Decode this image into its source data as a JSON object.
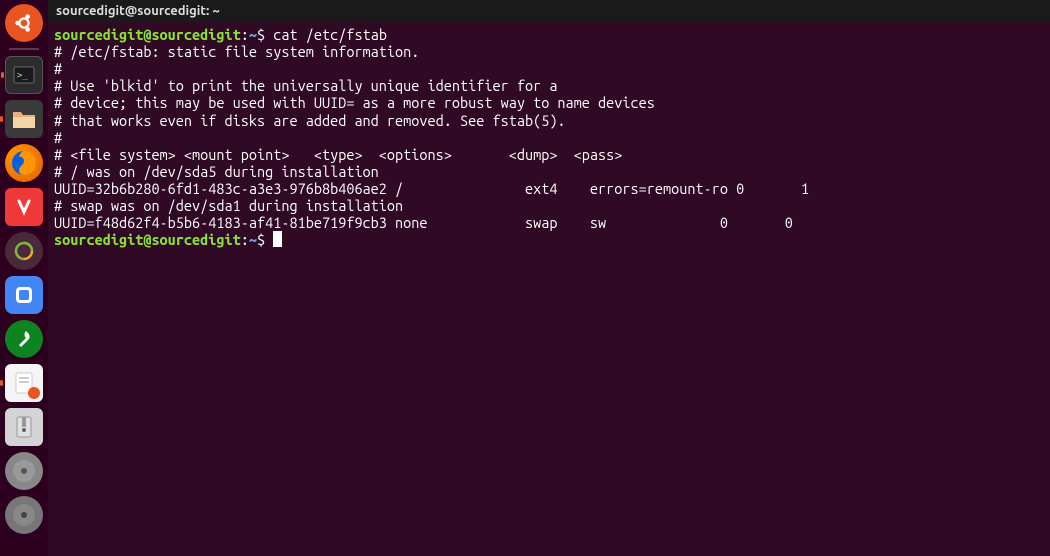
{
  "titlebar": {
    "text": "sourcedigit@sourcedigit: ~"
  },
  "prompt": {
    "userhost": "sourcedigit@sourcedigit",
    "colon": ":",
    "path": "~",
    "dollar": "$"
  },
  "command1": " cat /etc/fstab",
  "output": {
    "l1": "# /etc/fstab: static file system information.",
    "l2": "#",
    "l3": "# Use 'blkid' to print the universally unique identifier for a",
    "l4": "# device; this may be used with UUID= as a more robust way to name devices",
    "l5": "# that works even if disks are added and removed. See fstab(5).",
    "l6": "#",
    "l7": "# <file system> <mount point>   <type>  <options>       <dump>  <pass>",
    "l8": "# / was on /dev/sda5 during installation",
    "l9": "UUID=32b6b280-6fd1-483c-a3e3-976b8b406ae2 /               ext4    errors=remount-ro 0       1",
    "l10": "# swap was on /dev/sda1 during installation",
    "l11": "UUID=f48d62f4-b5b6-4183-af41-81be719f9cb3 none            swap    sw              0       0"
  },
  "command2": " "
}
